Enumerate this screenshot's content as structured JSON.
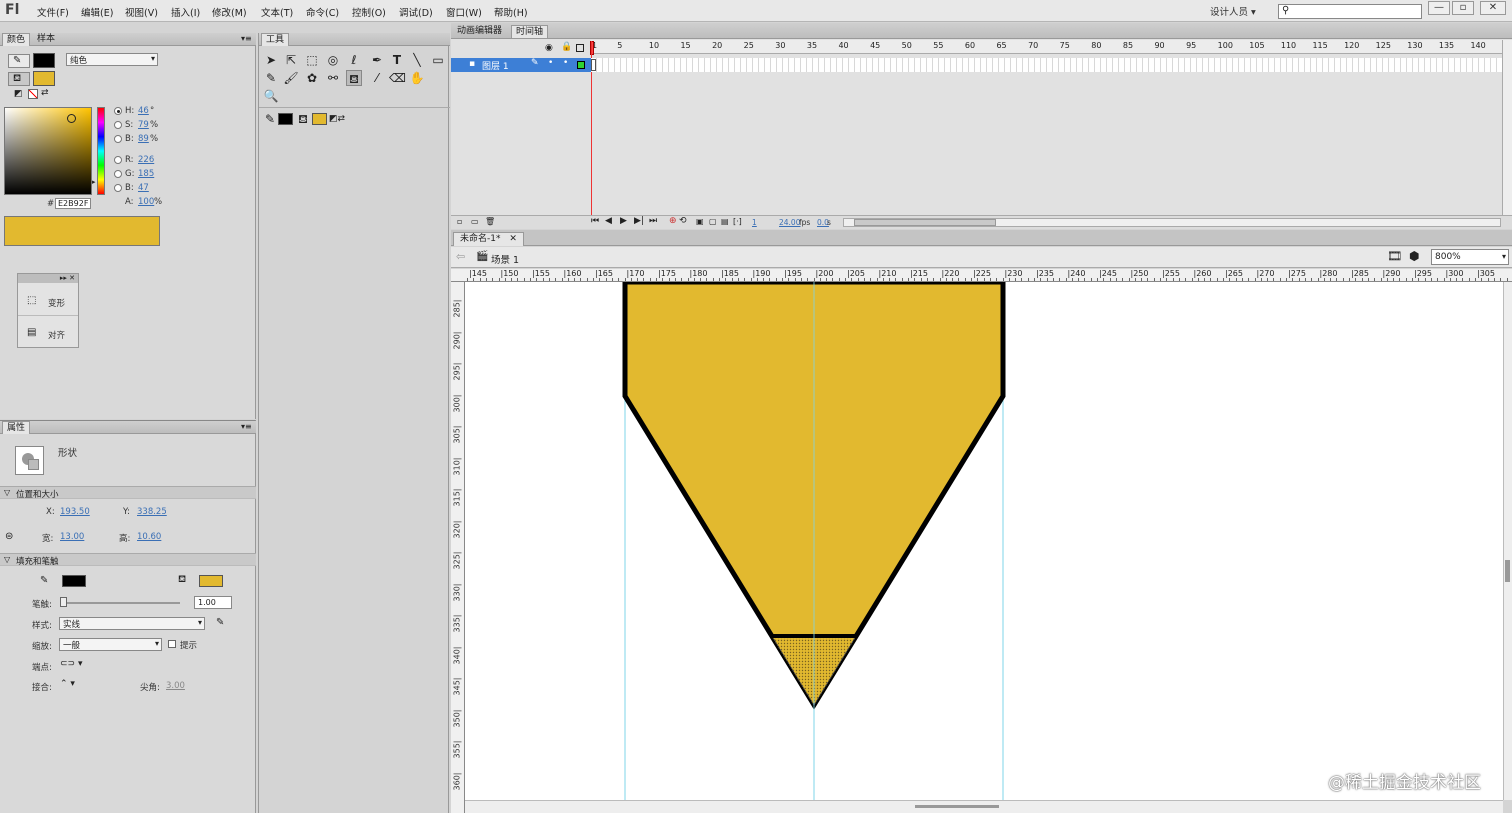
{
  "app": {
    "logo": "Fl",
    "workspace": "设计人员",
    "search_icon": "search-icon"
  },
  "menu": [
    "文件(F)",
    "编辑(E)",
    "视图(V)",
    "插入(I)",
    "修改(M)",
    "文本(T)",
    "命令(C)",
    "控制(O)",
    "调试(D)",
    "窗口(W)",
    "帮助(H)"
  ],
  "window_buttons": [
    "—",
    "▫",
    "✕"
  ],
  "color_panel": {
    "tabs": [
      "颜色",
      "样本"
    ],
    "fill_type": "纯色",
    "stroke_color": "#000000",
    "fill_color": "#E2B92F",
    "hsb": [
      {
        "label": "H:",
        "value": "46",
        "unit": "°"
      },
      {
        "label": "S:",
        "value": "79",
        "unit": "%"
      },
      {
        "label": "B:",
        "value": "89",
        "unit": "%"
      }
    ],
    "rgb": [
      {
        "label": "R:",
        "value": "226"
      },
      {
        "label": "G:",
        "value": "185"
      },
      {
        "label": "B:",
        "value": "47"
      }
    ],
    "alpha": {
      "label": "A:",
      "value": "100",
      "unit": "%"
    },
    "hex_label": "#",
    "hex": "E2B92F"
  },
  "mini_panel": {
    "items": [
      "变形",
      "对齐"
    ]
  },
  "tools_panel": {
    "title": "工具"
  },
  "properties": {
    "tab": "属性",
    "shape_type": "形状",
    "position_section": "位置和大小",
    "x_label": "X:",
    "x": "193.50",
    "y_label": "Y:",
    "y": "338.25",
    "w_label": "宽:",
    "w": "13.00",
    "h_label": "高:",
    "h": "10.60",
    "fill_section": "填充和笔触",
    "stroke_label": "笔触:",
    "stroke_value": "1.00",
    "style_label": "样式:",
    "style_value": "实线",
    "scale_label": "缩放:",
    "scale_value": "一般",
    "hint_label": "提示",
    "cap_label": "端点:",
    "join_label": "接合:",
    "miter_label": "尖角:",
    "miter_value": "3.00"
  },
  "timeline": {
    "tabs": [
      "动画编辑器",
      "时间轴"
    ],
    "layer_name": "图层 1",
    "frame_numbers": [
      "1",
      "5",
      "10",
      "15",
      "20",
      "25",
      "30",
      "35",
      "40",
      "45",
      "50",
      "55",
      "60",
      "65",
      "70",
      "75",
      "80",
      "85",
      "90",
      "95",
      "100",
      "105",
      "110",
      "115",
      "120",
      "125",
      "130",
      "135",
      "140"
    ],
    "current_frame": "1",
    "fps": "24.00",
    "fps_unit": "fps",
    "time": "0.0",
    "time_unit": "s"
  },
  "document": {
    "tab": "未命名-1*",
    "scene": "场景 1",
    "zoom": "800%",
    "h_ruler": [
      "145",
      "150",
      "155",
      "160",
      "165",
      "170",
      "175",
      "180",
      "185",
      "190",
      "195",
      "200",
      "205",
      "210",
      "215",
      "220",
      "225",
      "230",
      "235",
      "240",
      "245",
      "250",
      "255",
      "260",
      "265",
      "270",
      "275",
      "280",
      "285",
      "290",
      "295",
      "300",
      "305"
    ],
    "v_ruler": [
      "285",
      "290",
      "295",
      "300",
      "305",
      "310",
      "315",
      "320",
      "325",
      "330",
      "335",
      "340",
      "345",
      "350",
      "355",
      "360"
    ]
  },
  "watermark": "@稀土掘金技术社区",
  "colors": {
    "accent": "#E2B92F",
    "stroke": "#000000",
    "guide": "#7fd6e8",
    "layer_highlight": "#3d7fd6"
  }
}
